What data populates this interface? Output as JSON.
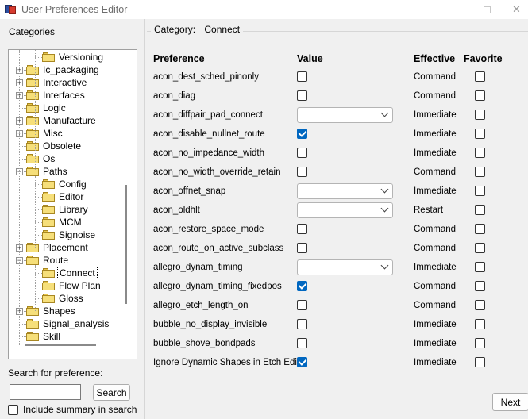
{
  "window": {
    "title": "User Preferences Editor",
    "close_glyph": "✕"
  },
  "left": {
    "categories_label": "Categories",
    "tree": [
      {
        "label": "Versioning",
        "level": 1,
        "expander": ""
      },
      {
        "label": "Ic_packaging",
        "level": 0,
        "expander": "+"
      },
      {
        "label": "Interactive",
        "level": 0,
        "expander": "+"
      },
      {
        "label": "Interfaces",
        "level": 0,
        "expander": "+"
      },
      {
        "label": "Logic",
        "level": 0,
        "expander": ""
      },
      {
        "label": "Manufacture",
        "level": 0,
        "expander": "+"
      },
      {
        "label": "Misc",
        "level": 0,
        "expander": "+"
      },
      {
        "label": "Obsolete",
        "level": 0,
        "expander": ""
      },
      {
        "label": "Os",
        "level": 0,
        "expander": ""
      },
      {
        "label": "Paths",
        "level": 0,
        "expander": "−"
      },
      {
        "label": "Config",
        "level": 1,
        "expander": ""
      },
      {
        "label": "Editor",
        "level": 1,
        "expander": ""
      },
      {
        "label": "Library",
        "level": 1,
        "expander": ""
      },
      {
        "label": "MCM",
        "level": 1,
        "expander": ""
      },
      {
        "label": "Signoise",
        "level": 1,
        "expander": ""
      },
      {
        "label": "Placement",
        "level": 0,
        "expander": "+"
      },
      {
        "label": "Route",
        "level": 0,
        "expander": "−"
      },
      {
        "label": "Connect",
        "level": 1,
        "expander": "",
        "selected": true
      },
      {
        "label": "Flow Plan",
        "level": 1,
        "expander": ""
      },
      {
        "label": "Gloss",
        "level": 1,
        "expander": ""
      },
      {
        "label": "Shapes",
        "level": 0,
        "expander": "+"
      },
      {
        "label": "Signal_analysis",
        "level": 0,
        "expander": ""
      },
      {
        "label": "Skill",
        "level": 0,
        "expander": ""
      }
    ],
    "search_label": "Search for preference:",
    "search_value": "",
    "search_button": "Search",
    "summary_label": "Include summary in search"
  },
  "right": {
    "category_label": "Category:",
    "category_value": "Connect",
    "columns": {
      "preference": "Preference",
      "value": "Value",
      "effective": "Effective",
      "favorite": "Favorite"
    },
    "rows": [
      {
        "name": "acon_dest_sched_pinonly",
        "kind": "checkbox",
        "checked": false,
        "effective": "Command",
        "favorite": false
      },
      {
        "name": "acon_diag",
        "kind": "checkbox",
        "checked": false,
        "effective": "Command",
        "favorite": false
      },
      {
        "name": "acon_diffpair_pad_connect",
        "kind": "dropdown",
        "value": "",
        "effective": "Immediate",
        "favorite": false
      },
      {
        "name": "acon_disable_nullnet_route",
        "kind": "checkbox",
        "checked": true,
        "effective": "Immediate",
        "favorite": false
      },
      {
        "name": "acon_no_impedance_width",
        "kind": "checkbox",
        "checked": false,
        "effective": "Immediate",
        "favorite": false
      },
      {
        "name": "acon_no_width_override_retain",
        "kind": "checkbox",
        "checked": false,
        "effective": "Command",
        "favorite": false
      },
      {
        "name": "acon_offnet_snap",
        "kind": "dropdown",
        "value": "",
        "effective": "Immediate",
        "favorite": false
      },
      {
        "name": "acon_oldhlt",
        "kind": "dropdown",
        "value": "",
        "effective": "Restart",
        "favorite": false
      },
      {
        "name": "acon_restore_space_mode",
        "kind": "checkbox",
        "checked": false,
        "effective": "Command",
        "favorite": false
      },
      {
        "name": "acon_route_on_active_subclass",
        "kind": "checkbox",
        "checked": false,
        "effective": "Command",
        "favorite": false
      },
      {
        "name": "allegro_dynam_timing",
        "kind": "dropdown",
        "value": "",
        "effective": "Immediate",
        "favorite": false
      },
      {
        "name": "allegro_dynam_timing_fixedpos",
        "kind": "checkbox",
        "checked": true,
        "effective": "Command",
        "favorite": false
      },
      {
        "name": "allegro_etch_length_on",
        "kind": "checkbox",
        "checked": false,
        "effective": "Command",
        "favorite": false
      },
      {
        "name": "bubble_no_display_invisible",
        "kind": "checkbox",
        "checked": false,
        "effective": "Immediate",
        "favorite": false
      },
      {
        "name": "bubble_shove_bondpads",
        "kind": "checkbox",
        "checked": false,
        "effective": "Immediate",
        "favorite": false
      },
      {
        "name": "Ignore Dynamic Shapes in Etch Edit",
        "kind": "checkbox",
        "checked": true,
        "effective": "Immediate",
        "favorite": false
      }
    ],
    "next_button": "Next"
  },
  "colors": {
    "checked_blue": "#0067c0",
    "folder_yellow": "#f6df7a"
  },
  "icons": {
    "app": "app-icon",
    "folder": "folder-icon",
    "chevron": "chevron-down-icon",
    "close": "close-icon",
    "minimize": "minimize-icon",
    "maximize": "maximize-icon"
  }
}
